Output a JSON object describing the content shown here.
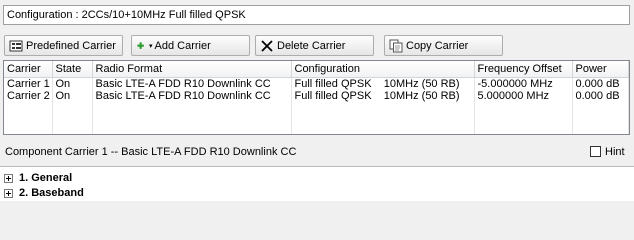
{
  "config_title": "Configuration : 2CCs/10+10MHz Full filled QPSK",
  "toolbar": {
    "predefined_label": "Predefined Carrier",
    "add_label": "Add Carrier",
    "delete_label": "Delete Carrier",
    "copy_label": "Copy Carrier",
    "add_icon_color": "#2e9c2e",
    "delete_icon_color": "#000000"
  },
  "grid": {
    "headers": {
      "carrier": "Carrier",
      "state": "State",
      "radio_format": "Radio Format",
      "configuration": "Configuration",
      "frequency_offset": "Frequency Offset",
      "power": "Power"
    },
    "rows": [
      {
        "carrier": "Carrier 1",
        "state": "On",
        "radio_format": "Basic LTE-A FDD R10 Downlink CC",
        "configuration": "Full filled QPSK    10MHz (50 RB)",
        "frequency_offset": "-5.000000 MHz",
        "power": "0.000 dB"
      },
      {
        "carrier": "Carrier 2",
        "state": "On",
        "radio_format": "Basic LTE-A FDD R10 Downlink CC",
        "configuration": "Full filled QPSK    10MHz (50 RB)",
        "frequency_offset": "5.000000 MHz",
        "power": "0.000 dB"
      }
    ]
  },
  "component_title": "Component Carrier 1 -- Basic LTE-A FDD R10 Downlink CC",
  "hint": {
    "label": "Hint",
    "checked": false
  },
  "tree": [
    {
      "label": "1. General",
      "icon": "plus-expander-icon"
    },
    {
      "label": "2. Baseband",
      "icon": "plus-expander-icon"
    }
  ]
}
